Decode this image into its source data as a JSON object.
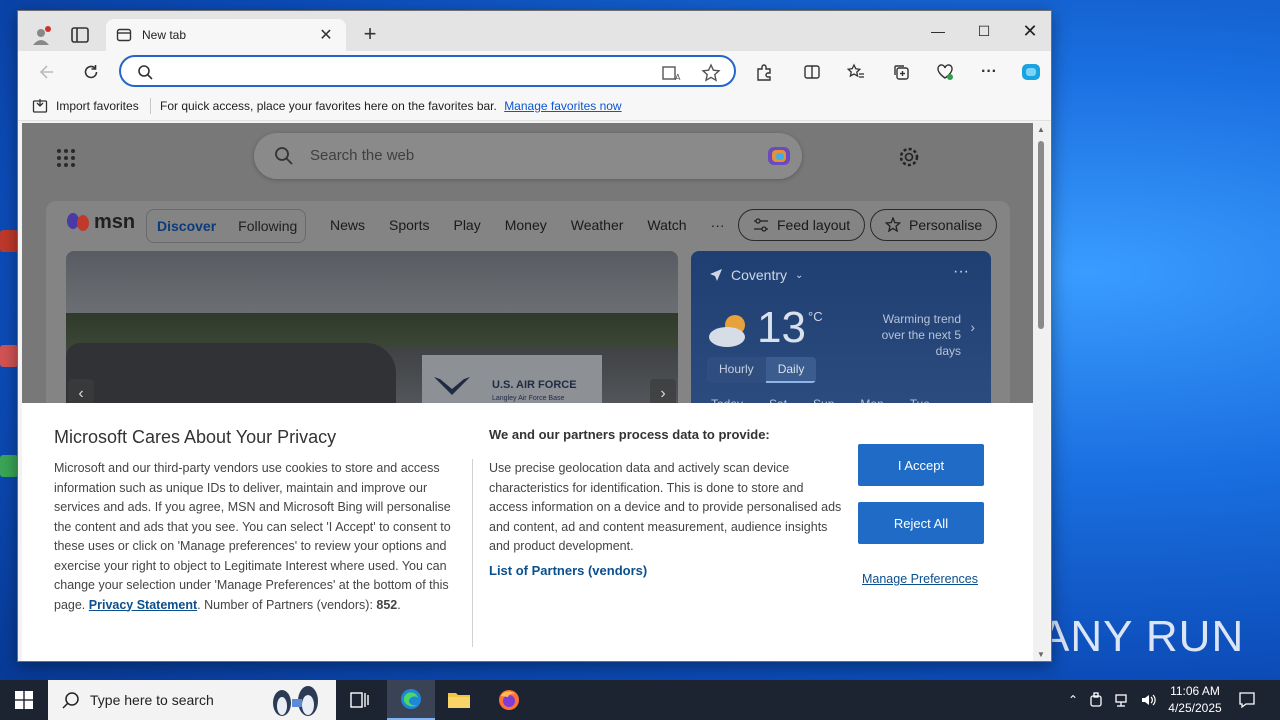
{
  "browser": {
    "tab_title": "New tab",
    "address_placeholder": "",
    "favorites_bar": {
      "import_label": "Import favorites",
      "hint_text": "For quick access, place your favorites here on the favorites bar.",
      "manage_link": "Manage favorites now"
    }
  },
  "ntp": {
    "search_placeholder": "Search the web"
  },
  "msn": {
    "logo_text": "msn",
    "tabs": [
      "Discover",
      "Following"
    ],
    "nav": [
      "News",
      "Sports",
      "Play",
      "Money",
      "Weather",
      "Watch",
      "···"
    ],
    "feed_layout_label": "Feed layout",
    "personalise_label": "Personalise",
    "hero_sign": "U.S. AIR FORCE",
    "hero_sign_sub": "Langley Air Force Base"
  },
  "weather": {
    "location": "Coventry",
    "temperature": "13",
    "unit": "°C",
    "trend_line1": "Warming trend",
    "trend_line2": "over the next 5 days",
    "toggle": [
      "Hourly",
      "Daily"
    ],
    "days": [
      "Today",
      "Sat",
      "Sun",
      "Mon",
      "Tue"
    ]
  },
  "privacy": {
    "title": "Microsoft Cares About Your Privacy",
    "body": "Microsoft and our third-party vendors use cookies to store and access information such as unique IDs to deliver, maintain and improve our services and ads. If you agree, MSN and Microsoft Bing will personalise the content and ads that you see. You can select 'I Accept' to consent to these uses or click on 'Manage preferences' to review your options and exercise your right to object to Legitimate Interest where used.  You can change your selection under 'Manage Preferences' at the bottom of this page.",
    "privacy_link": "Privacy Statement",
    "partners_count_label": "Number of Partners (vendors):",
    "partners_count": "852",
    "heading2": "We and our partners process data to provide:",
    "body2": "Use precise geolocation data and actively scan device characteristics for identification. This is done to store and access information on a device and to provide personalised ads and content, ad and content measurement, audience insights and product development.",
    "partners_link": "List of Partners (vendors)",
    "accept_label": "I Accept",
    "reject_label": "Reject All",
    "manage_label": "Manage Preferences"
  },
  "taskbar": {
    "search_placeholder": "Type here to search",
    "time": "11:06 AM",
    "date": "4/25/2025"
  },
  "watermark": "ANY RUN",
  "colors": {
    "accent": "#1f6bc5",
    "link": "#0b4f8c",
    "address_focus": "#2266cc"
  }
}
